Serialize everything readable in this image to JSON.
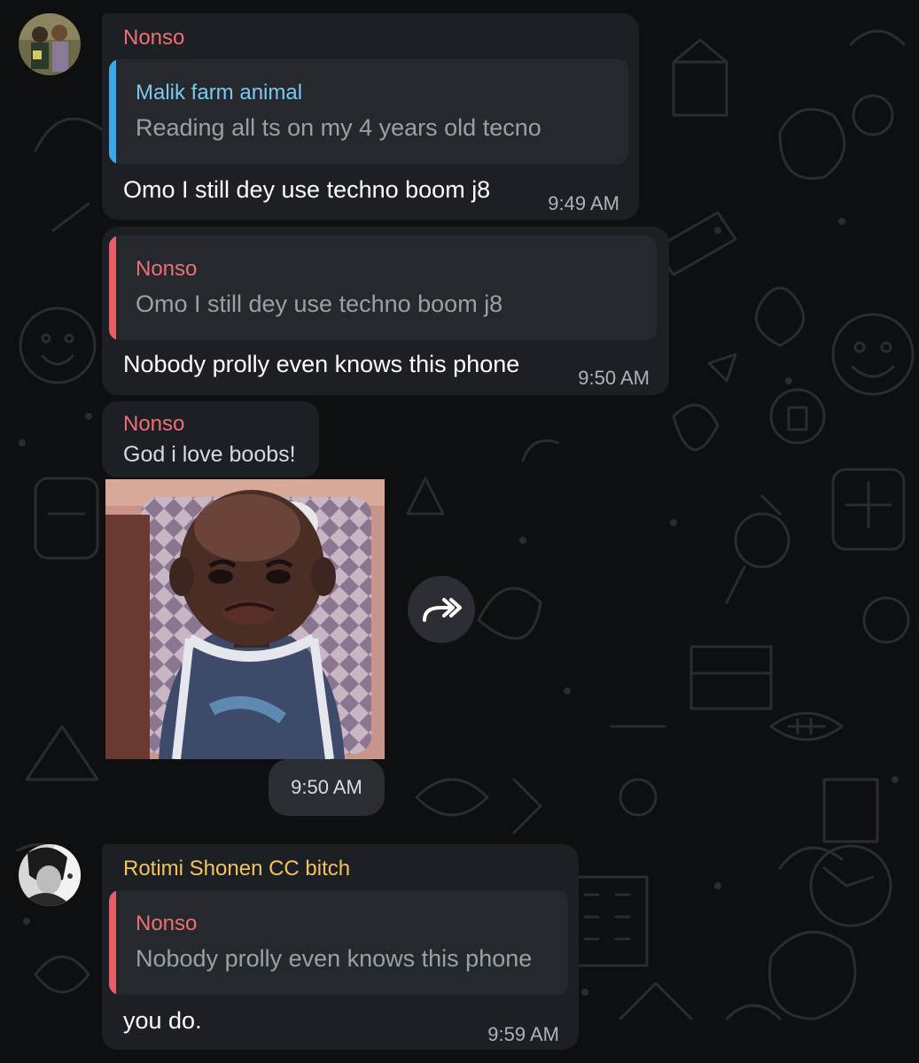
{
  "colors": {
    "nonso": "#ee6f73",
    "malik": "#7cc8f0",
    "rotimi": "#f2c45a",
    "bubble": "#1c1f23",
    "reply_bg": "#25292e",
    "reply_bar_blue": "#3ba8e8",
    "reply_bar_red": "#e85d66"
  },
  "messages": [
    {
      "sender": "Nonso",
      "reply": {
        "name": "Malik farm animal",
        "text": "Reading all ts on my 4 years old tecno"
      },
      "text": "Omo I still dey use techno boom j8",
      "time": "9:49 AM"
    },
    {
      "reply": {
        "name": "Nonso",
        "text": "Omo I still dey use techno boom j8"
      },
      "text": "Nobody prolly even knows this phone",
      "time": "9:50 AM"
    },
    {
      "sender": "Nonso",
      "caption": "God i love boobs!",
      "time": "9:50 AM",
      "forward_icon": "forward-icon"
    },
    {
      "sender": "Rotimi Shonen CC bitch",
      "reply": {
        "name": "Nonso",
        "text": "Nobody prolly even knows this phone"
      },
      "text": "you do.",
      "time": "9:59 AM"
    }
  ]
}
